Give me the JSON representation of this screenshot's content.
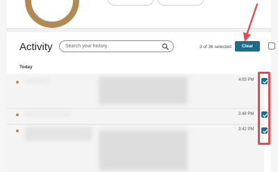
{
  "activity": {
    "title": "Activity",
    "search_placeholder": "Search your history",
    "selected_count_text": "3 of 36 selected",
    "clear_label": "Clear"
  },
  "sections": [
    {
      "label": "Today",
      "items": [
        {
          "time": "4:05 PM",
          "checked": true
        },
        {
          "time": "3:48 PM",
          "checked": true
        },
        {
          "time": "3:42 PM",
          "checked": true
        }
      ]
    }
  ],
  "colors": {
    "accent": "#1e6b8a",
    "annotation_red": "#e5484d",
    "ring_brown": "#b18a55"
  }
}
